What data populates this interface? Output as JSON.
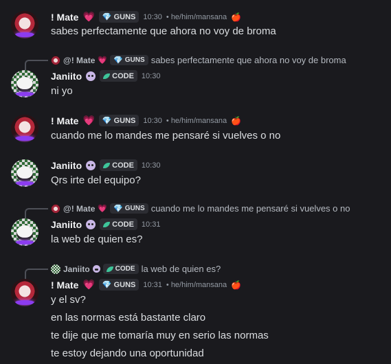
{
  "users": {
    "mate": "! Mate",
    "mate_reply": "@! Mate",
    "janiito": "Janiito"
  },
  "tags": {
    "guns": "GUNS",
    "code": "CODE"
  },
  "pronouns": "• he/him/mansana",
  "icons": {
    "heart": "💗",
    "gem": "💎",
    "apple": "🍎",
    "leaf": "leaf-icon",
    "panda": "panda-icon"
  },
  "messages": {
    "m1": {
      "time": "10:30",
      "text": "sabes perfectamente que ahora no voy de broma"
    },
    "m2": {
      "reply_text": "sabes perfectamente que ahora no voy de broma",
      "time": "10:30",
      "text": "ni yo"
    },
    "m3": {
      "time": "10:30",
      "text": "cuando me lo mandes me pensaré si vuelves o no"
    },
    "m4": {
      "time": "10:30",
      "text": "Qrs irte del equipo?"
    },
    "m5": {
      "reply_text": "cuando me lo mandes me pensaré si vuelves o no",
      "time": "10:31",
      "text": "la web de quien es?"
    },
    "m6": {
      "reply_text": "la web de quien es?",
      "time": "10:31",
      "lines": [
        "y el sv?",
        "en las normas está bastante claro",
        "te dije que me tomaría muy en serio las normas",
        "te estoy dejando una oportunidad"
      ]
    }
  }
}
